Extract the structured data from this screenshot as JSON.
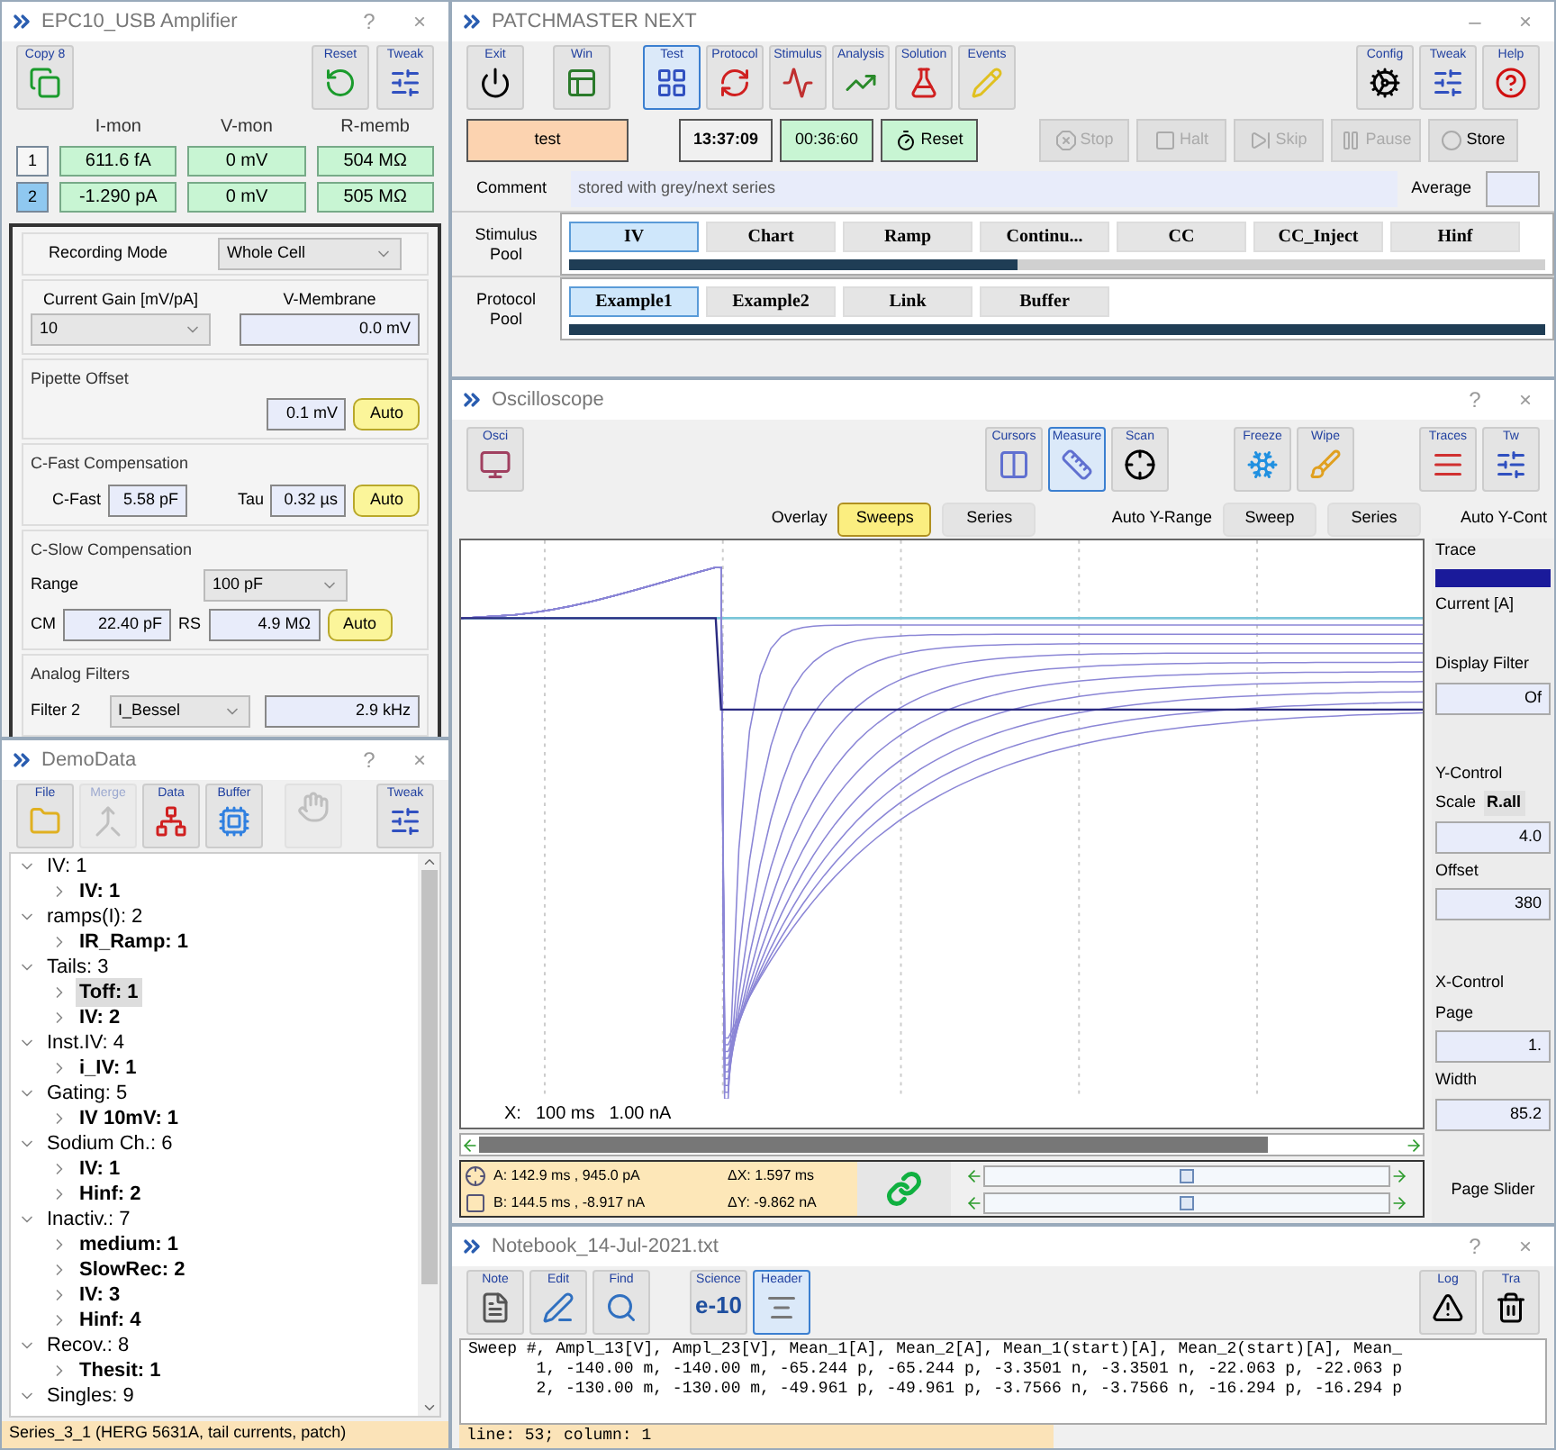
{
  "amplifier": {
    "title": "EPC10_USB Amplifier",
    "controls": [
      "?",
      "×"
    ],
    "toolbar": [
      {
        "label": "Copy 8"
      },
      {
        "label": "Reset"
      },
      {
        "label": "Tweak"
      }
    ],
    "columns": [
      "I-mon",
      "V-mon",
      "R-memb"
    ],
    "rows": [
      {
        "channel": "1",
        "selected": false,
        "values": [
          "611.6 fA",
          "0 mV",
          "504 MΩ"
        ]
      },
      {
        "channel": "2",
        "selected": true,
        "values": [
          "-1.290 pA",
          "0 mV",
          "505 MΩ"
        ]
      }
    ],
    "recording_mode": {
      "label": "Recording Mode",
      "value": "Whole Cell"
    },
    "current_gain": {
      "label": "Current Gain [mV/pA]",
      "value": "10"
    },
    "v_membrane": {
      "label": "V-Membrane",
      "value": "0.0 mV"
    },
    "pipette_offset": {
      "title": "Pipette Offset",
      "value": "0.1 mV",
      "button": "Auto"
    },
    "c_fast": {
      "title": "C-Fast Compensation",
      "cfast_label": "C-Fast",
      "cfast_value": "5.58 pF",
      "tau_label": "Tau",
      "tau_value": "0.32 µs",
      "button": "Auto"
    },
    "c_slow": {
      "title": "C-Slow Compensation",
      "range_label": "Range",
      "range_value": "100 pF",
      "cm_label": "CM",
      "cm_value": "22.40 pF",
      "rs_label": "RS",
      "rs_value": "4.9 MΩ",
      "button": "Auto"
    },
    "analog_filters": {
      "title": "Analog Filters",
      "filter_label": "Filter 2",
      "filter_value": "I_Bessel",
      "freq_value": "2.9 kHz"
    }
  },
  "data_tree": {
    "title": "DemoData",
    "controls": [
      "?",
      "×"
    ],
    "toolbar": [
      {
        "label": "File",
        "disabled": false
      },
      {
        "label": "Merge",
        "disabled": true
      },
      {
        "label": "Data",
        "disabled": false
      },
      {
        "label": "Buffer",
        "disabled": false
      },
      {
        "disabled": true
      },
      {
        "label": "Tweak",
        "disabled": false
      }
    ],
    "items": [
      {
        "label": "IV: 1",
        "expanded": true,
        "selected": false,
        "children": [
          {
            "label": "IV: 1",
            "expanded": false,
            "selected": false
          }
        ]
      },
      {
        "label": "ramps(I): 2",
        "expanded": true,
        "selected": false,
        "children": [
          {
            "label": "IR_Ramp: 1",
            "expanded": false,
            "selected": false
          }
        ]
      },
      {
        "label": "Tails: 3",
        "expanded": true,
        "selected": false,
        "children": [
          {
            "label": "Toff: 1",
            "expanded": false,
            "selected": true
          },
          {
            "label": "IV: 2",
            "expanded": false,
            "selected": false
          }
        ]
      },
      {
        "label": "Inst.IV: 4",
        "expanded": true,
        "selected": false,
        "children": [
          {
            "label": "i_IV: 1",
            "expanded": false,
            "selected": false
          }
        ]
      },
      {
        "label": "Gating: 5",
        "expanded": true,
        "selected": false,
        "children": [
          {
            "label": "IV 10mV: 1",
            "expanded": false,
            "selected": false
          }
        ]
      },
      {
        "label": "Sodium Ch.: 6",
        "expanded": true,
        "selected": false,
        "children": [
          {
            "label": "IV: 1",
            "expanded": false,
            "selected": false
          },
          {
            "label": "Hinf: 2",
            "expanded": false,
            "selected": false
          }
        ]
      },
      {
        "label": "Inactiv.: 7",
        "expanded": true,
        "selected": false,
        "children": [
          {
            "label": "medium: 1",
            "expanded": false,
            "selected": false
          },
          {
            "label": "SlowRec: 2",
            "expanded": false,
            "selected": false
          },
          {
            "label": "IV: 3",
            "expanded": false,
            "selected": false
          },
          {
            "label": "Hinf: 4",
            "expanded": false,
            "selected": false
          }
        ]
      },
      {
        "label": "Recov.: 8",
        "expanded": true,
        "selected": false,
        "children": [
          {
            "label": "Thesit: 1",
            "expanded": false,
            "selected": false
          }
        ]
      },
      {
        "label": "Singles: 9",
        "expanded": true,
        "selected": false
      }
    ],
    "status_bar": "Series_3_1 (HERG 5631A, tail currents, patch)"
  },
  "patchmaster": {
    "title": "PATCHMASTER NEXT",
    "controls": [
      "–",
      "×"
    ],
    "toolbar": [
      {
        "label": "Exit",
        "selected": false
      },
      {
        "label": "Win",
        "selected": false
      },
      {
        "label": "Test",
        "selected": true
      },
      {
        "label": "Protocol",
        "selected": false
      },
      {
        "label": "Stimulus",
        "selected": false
      },
      {
        "label": "Analysis",
        "selected": false
      },
      {
        "label": "Solution",
        "selected": false
      },
      {
        "label": "Events",
        "selected": false
      },
      {
        "label": "Config",
        "selected": false
      },
      {
        "label": "Tweak",
        "selected": false
      },
      {
        "label": "Help",
        "selected": false
      }
    ],
    "name_field": "test",
    "clock": "13:37:09",
    "timer": "00:36:60",
    "reset_button": "Reset",
    "run_buttons": [
      {
        "label": "Stop",
        "disabled": true
      },
      {
        "label": "Halt",
        "disabled": true
      },
      {
        "label": "Skip",
        "disabled": true
      },
      {
        "label": "Pause",
        "disabled": true
      },
      {
        "label": "Store",
        "disabled": false
      }
    ],
    "comment": {
      "label": "Comment",
      "value": "stored with grey/next series"
    },
    "average": {
      "label": "Average"
    },
    "stimulus_pool": {
      "label": "Stimulus Pool",
      "items": [
        {
          "label": "IV",
          "selected": true
        },
        {
          "label": "Chart",
          "selected": false
        },
        {
          "label": "Ramp",
          "selected": false
        },
        {
          "label": "Continu...",
          "selected": false
        },
        {
          "label": "CC",
          "selected": false
        },
        {
          "label": "CC_Inject",
          "selected": false
        },
        {
          "label": "Hinf",
          "selected": false
        }
      ]
    },
    "protocol_pool": {
      "label": "Protocol Pool",
      "items": [
        {
          "label": "Example1",
          "selected": true
        },
        {
          "label": "Example2",
          "selected": false
        },
        {
          "label": "Link",
          "selected": false
        },
        {
          "label": "Buffer",
          "selected": false
        }
      ]
    }
  },
  "oscilloscope": {
    "title": "Oscilloscope",
    "controls": [
      "?",
      "×"
    ],
    "toolbar": [
      {
        "label": "Osci",
        "selected": false
      },
      {
        "label": "Cursors",
        "selected": false
      },
      {
        "label": "Measure",
        "selected": true
      },
      {
        "label": "Scan",
        "selected": false
      },
      {
        "label": "Freeze",
        "selected": false
      },
      {
        "label": "Wipe",
        "selected": false
      },
      {
        "label": "Traces",
        "selected": false
      },
      {
        "label": "Tw",
        "selected": false
      }
    ],
    "overlay": {
      "label": "Overlay",
      "options": [
        {
          "label": "Sweeps",
          "selected": true
        },
        {
          "label": "Series",
          "selected": false
        }
      ]
    },
    "auto_y_range": {
      "label": "Auto Y-Range",
      "options": [
        {
          "label": "Sweep",
          "selected": false
        },
        {
          "label": "Series",
          "selected": false
        }
      ]
    },
    "auto_y_control": "Auto Y-Cont",
    "scale_bar": {
      "label": "X:",
      "time": "100 ms",
      "current": "1.00 nA"
    },
    "side_panel": {
      "trace_label": "Trace",
      "trace_unit": "Current [A]",
      "display_filter_label": "Display Filter",
      "display_filter_value": "Of",
      "y_control": "Y-Control",
      "scale_label": "Scale",
      "scale_button": "R.all",
      "scale_value": "4.0",
      "offset_label": "Offset",
      "offset_value": "380",
      "x_control": "X-Control",
      "page_label": "Page",
      "page_value": "1.",
      "width_label": "Width",
      "width_value": "85.2",
      "page_slider": "Page Slider"
    },
    "cursors": {
      "a": "A: 142.9 ms , 945.0 pA",
      "dx": "ΔX: 1.597 ms",
      "b": "B: 144.5 ms , -8.917 nA",
      "dy": "ΔY: -9.862 nA"
    },
    "cursor_sliders": [
      {
        "level": 0.5
      },
      {
        "level": 0.5
      }
    ]
  },
  "notebook": {
    "title": "Notebook_14-Jul-2021.txt",
    "controls": [
      "?",
      "×"
    ],
    "toolbar": [
      {
        "label": "Note",
        "selected": false
      },
      {
        "label": "Edit",
        "selected": false
      },
      {
        "label": "Find",
        "selected": false
      },
      {
        "label": "Science",
        "selected": false,
        "text": "e-10"
      },
      {
        "label": "Header",
        "selected": true
      },
      {
        "label": "Log",
        "selected": false
      },
      {
        "label": "Tra",
        "selected": false
      }
    ],
    "lines": [
      "Sweep #, Ampl_13[V], Ampl_23[V], Mean_1[A], Mean_2[A], Mean_1(start)[A], Mean_2(start)[A], Mean_",
      "       1, -140.00 m, -140.00 m, -65.244 p, -65.244 p, -3.3501 n, -3.3501 n, -22.063 p, -22.063 p",
      "       2, -130.00 m, -130.00 m, -49.961 p, -49.961 p, -3.7566 n, -3.7566 n, -16.294 p, -16.294 p"
    ],
    "status_bar": "line: 53; column: 1"
  }
}
